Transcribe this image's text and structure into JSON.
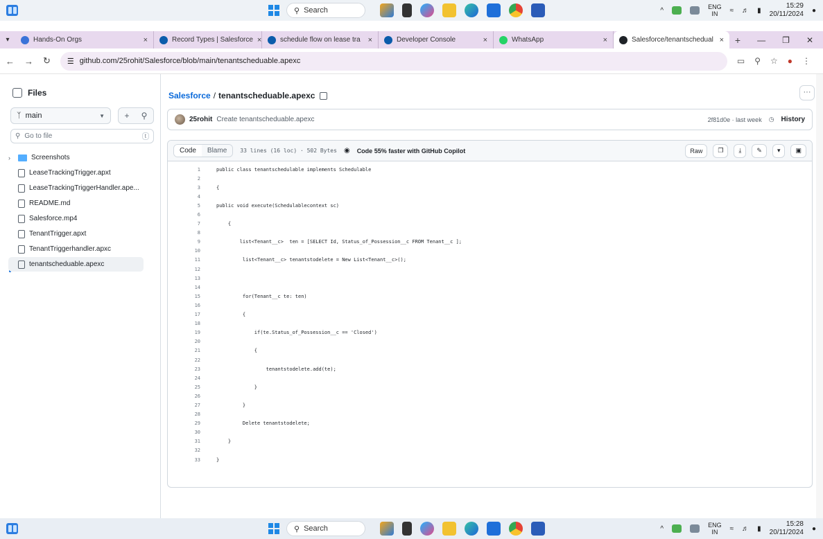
{
  "taskbar_top": {
    "search_label": "Search",
    "lang": "ENG",
    "region": "IN",
    "time": "15:29",
    "date": "20/11/2024"
  },
  "taskbar_bottom": {
    "search_label": "Search",
    "lang": "ENG",
    "region": "IN",
    "time": "15:28",
    "date": "20/11/2024"
  },
  "taskbar_apps": [
    "copilot-icon",
    "file-explorer-icon",
    "copilot-app-icon",
    "folder-icon",
    "edge-icon",
    "store-icon",
    "chrome-icon",
    "word-icon"
  ],
  "tabs": [
    {
      "title": "Hands-On Orgs",
      "color": "#3a73d8"
    },
    {
      "title": "Record Types | Salesforce",
      "color": "#0b5cab"
    },
    {
      "title": "schedule flow on lease tra",
      "color": "#0b5cab"
    },
    {
      "title": "Developer Console",
      "color": "#0b5cab"
    },
    {
      "title": "WhatsApp",
      "color": "#25d366"
    },
    {
      "title": "Salesforce/tenantschedual",
      "color": "#1f2328"
    }
  ],
  "address": {
    "url": "github.com/25rohit/Salesforce/blob/main/tenantscheduable.apexc"
  },
  "sidebar": {
    "title": "Files",
    "branch": "main",
    "goto_placeholder": "Go to file",
    "goto_shortcut": "t",
    "items": [
      {
        "label": "Screenshots",
        "type": "folder"
      },
      {
        "label": "LeaseTrackingTrigger.apxt",
        "type": "file"
      },
      {
        "label": "LeaseTrackingTriggerHandler.ape...",
        "type": "file"
      },
      {
        "label": "README.md",
        "type": "file"
      },
      {
        "label": "Salesforce.mp4",
        "type": "file"
      },
      {
        "label": "TenantTrigger.apxt",
        "type": "file"
      },
      {
        "label": "TenantTriggerhandler.apxc",
        "type": "file"
      },
      {
        "label": "tenantscheduable.apexc",
        "type": "file",
        "active": true
      }
    ]
  },
  "breadcrumb": {
    "repo": "Salesforce",
    "sep": "/",
    "file": "tenantscheduable.apexc"
  },
  "commit": {
    "author": "25rohit",
    "message": "Create tenantscheduable.apexc",
    "hash_time": "2f81d0e · last week",
    "history": "History"
  },
  "code_header": {
    "tab_code": "Code",
    "tab_blame": "Blame",
    "meta": "33 lines (16 loc) · 502 Bytes",
    "copilot": "Code 55% faster with GitHub Copilot",
    "raw": "Raw"
  },
  "code_lines": [
    "public class tenantschedulable implements Schedulable",
    "",
    "{",
    "",
    "public void execute(Schedulablecontext sc)",
    "",
    "    {",
    "",
    "        list<Tenant__c>  ten = [SELECT Id, Status_of_Possession__c FROM Tenant__c ];",
    "",
    "         list<Tenant__c> tenantstodelete = New List<Tenant__c>();",
    "",
    "",
    "",
    "         for(Tenant__c te: ten)",
    "",
    "         {",
    "",
    "             if(te.Status_of_Possession__c == 'Closed')",
    "",
    "             {",
    "",
    "                 tenantstodelete.add(te);",
    "",
    "             }",
    "",
    "         }",
    "",
    "         Delete tenantstodelete;",
    "",
    "    }",
    "",
    "}"
  ]
}
